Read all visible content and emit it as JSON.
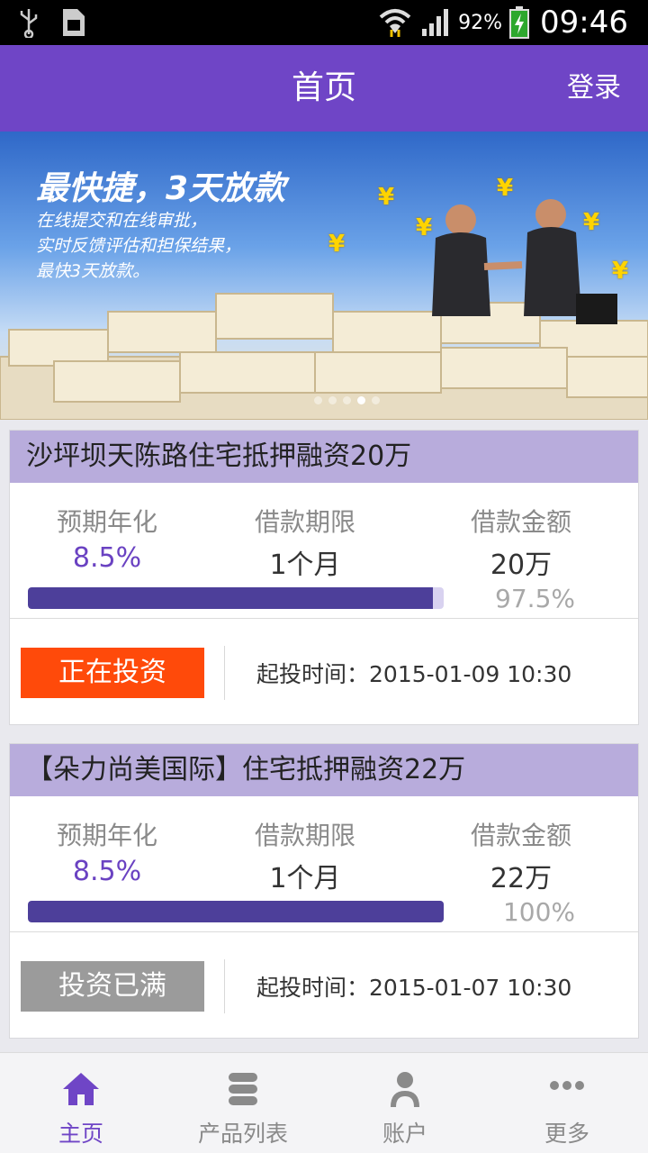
{
  "status_bar": {
    "battery": "92%",
    "time": "09:46"
  },
  "header": {
    "title": "首页",
    "login": "登录"
  },
  "banner": {
    "headline": "最快捷，3天放款",
    "lines": [
      "在线提交和在线审批，",
      "实时反馈评估和担保结果，",
      "最快3天放款。"
    ],
    "currency_symbol": "¥"
  },
  "labels": {
    "rate": "预期年化",
    "term": "借款期限",
    "amount": "借款金额",
    "start_prefix": "起投时间："
  },
  "products": [
    {
      "title": "沙坪坝天陈路住宅抵押融资20万",
      "rate": "8.5%",
      "term": "1个月",
      "amount": "20万",
      "progress_text": "97.5%",
      "progress": 0.975,
      "status": "正在投资",
      "start_time": "2015-01-09 10:30"
    },
    {
      "title": "【朵力尚美国际】住宅抵押融资22万",
      "rate": "8.5%",
      "term": "1个月",
      "amount": "22万",
      "progress_text": "100%",
      "progress": 1.0,
      "status": "投资已满",
      "start_time": "2015-01-07 10:30"
    }
  ],
  "nav": [
    {
      "label": "主页",
      "icon": "home-icon",
      "active": true
    },
    {
      "label": "产品列表",
      "icon": "list-icon",
      "active": false
    },
    {
      "label": "账户",
      "icon": "user-icon",
      "active": false
    },
    {
      "label": "更多",
      "icon": "more-icon",
      "active": false
    }
  ],
  "colors": {
    "primary": "#6f45c6",
    "active_status": "#ff4a0a",
    "full_status": "#9b9b9b",
    "progress": "#4d3f9a"
  }
}
